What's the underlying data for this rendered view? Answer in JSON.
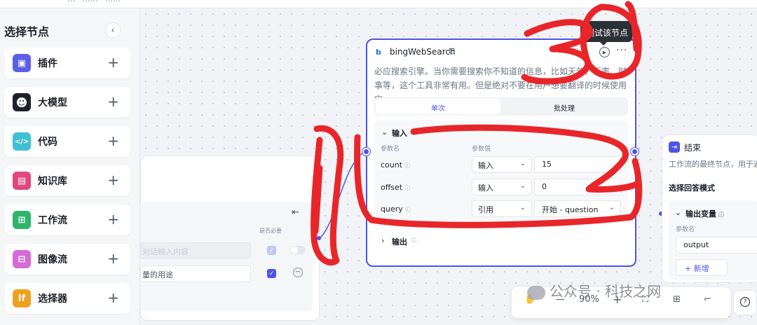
{
  "topbar": {
    "breadcrumb": "…  ·  ……  ·  ……"
  },
  "sidebar": {
    "title": "选择节点",
    "collapse_glyph": "‹",
    "plus_glyph": "+",
    "items": [
      {
        "label": "插件",
        "icon": "plugin-icon",
        "glyph": "▣",
        "color": "#5b5fe8"
      },
      {
        "label": "大模型",
        "icon": "llm-icon",
        "glyph": "☻",
        "color": "#1d2129"
      },
      {
        "label": "代码",
        "icon": "code-icon",
        "glyph": "</>",
        "color": "#3ec1d3"
      },
      {
        "label": "知识库",
        "icon": "knowledge-icon",
        "glyph": "▤",
        "color": "#e0477a"
      },
      {
        "label": "工作流",
        "icon": "workflow-icon",
        "glyph": "⊞",
        "color": "#2fb46b"
      },
      {
        "label": "图像流",
        "icon": "imageflow-icon",
        "glyph": "⊟",
        "color": "#d46bd6"
      },
      {
        "label": "选择器",
        "icon": "selector-icon",
        "glyph": "If",
        "color": "#f0a020"
      }
    ]
  },
  "left_node": {
    "required_header": "是否必要",
    "input1_placeholder": "对话输入内容",
    "input2_value": "量的用途"
  },
  "bing_node": {
    "logo": "b",
    "title": "bingWebSearch",
    "title_icon": "⊟",
    "tooltip": "测试该节点",
    "run_glyph": "▶",
    "more": "···",
    "description": "必应搜索引擎。当你需要搜索你不知道的信息，比如天气、汇率、时事等，这个工具非常有用。但是绝对不要在用户想要翻译的时候使用它。",
    "tabs": [
      {
        "label": "单次",
        "active": true
      },
      {
        "label": "批处理",
        "active": false
      }
    ],
    "input_section": {
      "title": "输入",
      "col_param_name": "参数名",
      "col_param_value": "参数值",
      "rows": [
        {
          "name": "count",
          "mode": "输入",
          "value": "15",
          "has_chevron": false
        },
        {
          "name": "offset",
          "mode": "输入",
          "value": "0",
          "has_chevron": false
        },
        {
          "name": "query",
          "mode": "引用",
          "value": "开始 - question",
          "has_chevron": true
        }
      ]
    },
    "output_section": {
      "title": "输出"
    }
  },
  "end_node": {
    "icon": "⇥",
    "title": "结束",
    "description": "工作流的最终节点，用于返",
    "mode_label": "选择回答模式",
    "output_var_title": "输出变量",
    "param_header": "参数名",
    "output_value": "output",
    "add_label": "+ 新增"
  },
  "toolbar": {
    "hand": "✋",
    "minus": "—",
    "zoom": "90%",
    "plus": "+",
    "fit": "⛶",
    "grid": "⊞",
    "more": "⌐",
    "help": "?"
  },
  "watermark": "公众号 · 科技之网",
  "colors": {
    "accent": "#4d53e8",
    "annotation_red": "#e8262a"
  }
}
